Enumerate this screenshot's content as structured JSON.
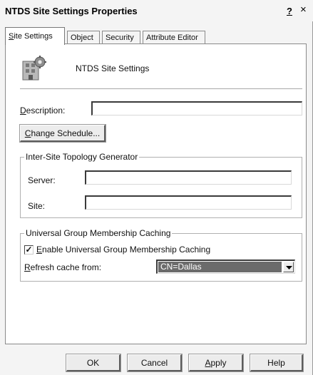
{
  "window": {
    "title": "NTDS Site Settings Properties",
    "help_glyph": "?",
    "close_glyph": "×"
  },
  "tabs": [
    {
      "label": "Site Settings",
      "mnemonic": "S",
      "rest": "ite Settings",
      "active": true
    },
    {
      "label": "Object",
      "active": false
    },
    {
      "label": "Security",
      "active": false
    },
    {
      "label": "Attribute Editor",
      "active": false
    }
  ],
  "general": {
    "icon": "site-settings-icon",
    "object_name": "NTDS Site Settings",
    "description_label_pre": "",
    "description_label_mn": "D",
    "description_label_post": "escription:",
    "description_value": "",
    "change_schedule_pre": "",
    "change_schedule_mn": "C",
    "change_schedule_post": "hange Schedule..."
  },
  "istg": {
    "title": "Inter-Site Topology Generator",
    "server_label": "Server:",
    "server_value": "",
    "site_label": "Site:",
    "site_value": ""
  },
  "ugmc": {
    "title": "Universal Group Membership Caching",
    "enable_checked": true,
    "enable_label_pre": "",
    "enable_label_mn": "E",
    "enable_label_post": "nable Universal Group Membership Caching",
    "check_glyph": "✓",
    "refresh_label_pre": "",
    "refresh_label_mn": "R",
    "refresh_label_post": "efresh cache from:",
    "refresh_value": "CN=Dallas"
  },
  "footer": {
    "ok": "OK",
    "cancel": "Cancel",
    "apply_pre": "",
    "apply_mn": "A",
    "apply_post": "pply",
    "help": "Help"
  },
  "colors": {
    "dialog_bg": "#f4f4f4",
    "panel_bg": "#ffffff",
    "selection": "#6b6b6b"
  }
}
